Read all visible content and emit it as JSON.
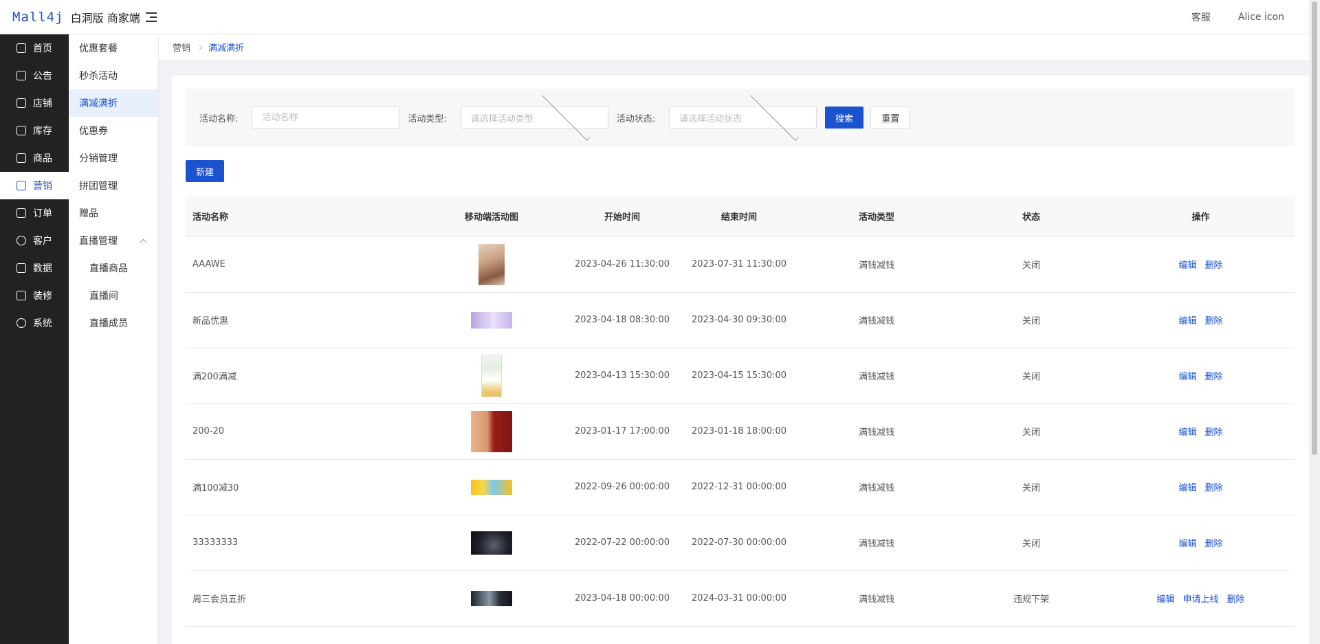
{
  "header": {
    "logo_mark": "Mall4j",
    "logo_text": "白洞版 商家端",
    "service_label": "客服",
    "user_label": "Alice icon"
  },
  "sidebar": {
    "items": [
      {
        "label": "首页",
        "icon": "home-icon"
      },
      {
        "label": "公告",
        "icon": "notice-icon"
      },
      {
        "label": "店铺",
        "icon": "shop-icon"
      },
      {
        "label": "库存",
        "icon": "inventory-icon"
      },
      {
        "label": "商品",
        "icon": "product-icon"
      },
      {
        "label": "营销",
        "icon": "gift-icon",
        "active": true
      },
      {
        "label": "订单",
        "icon": "order-icon"
      },
      {
        "label": "客户",
        "icon": "user-icon"
      },
      {
        "label": "数据",
        "icon": "data-icon"
      },
      {
        "label": "装修",
        "icon": "decorate-icon"
      },
      {
        "label": "系统",
        "icon": "settings-icon"
      }
    ]
  },
  "submenu": {
    "items": [
      {
        "label": "优惠套餐"
      },
      {
        "label": "秒杀活动"
      },
      {
        "label": "满减满折",
        "active": true
      },
      {
        "label": "优惠券"
      },
      {
        "label": "分销管理"
      },
      {
        "label": "拼团管理"
      },
      {
        "label": "赠品"
      },
      {
        "label": "直播管理"
      },
      {
        "label": "直播商品"
      },
      {
        "label": "直播间"
      },
      {
        "label": "直播成员"
      }
    ]
  },
  "breadcrumb": {
    "parent": "营销",
    "current": "满减满折"
  },
  "search": {
    "name_label": "活动名称:",
    "name_placeholder": "活动名称",
    "type_label": "活动类型:",
    "type_placeholder": "请选择活动类型",
    "status_label": "活动状态:",
    "status_placeholder": "请选择活动状态",
    "search_button": "搜索",
    "reset_button": "重置"
  },
  "new_button": "新建",
  "table": {
    "columns": [
      "活动名称",
      "移动端活动图",
      "开始时间",
      "结束时间",
      "活动类型",
      "状态",
      "操作"
    ],
    "rows": [
      {
        "name": "AAAWE",
        "start": "2023-04-26 11:30:00",
        "end": "2023-07-31 11:30:00",
        "type": "满钱减钱",
        "status": "关闭",
        "ops": [
          "编辑",
          "删除"
        ]
      },
      {
        "name": "新品优惠",
        "start": "2023-04-18 08:30:00",
        "end": "2023-04-30 09:30:00",
        "type": "满钱减钱",
        "status": "关闭",
        "ops": [
          "编辑",
          "删除"
        ]
      },
      {
        "name": "满200满减",
        "start": "2023-04-13 15:30:00",
        "end": "2023-04-15 15:30:00",
        "type": "满钱减钱",
        "status": "关闭",
        "ops": [
          "编辑",
          "删除"
        ]
      },
      {
        "name": "200-20",
        "start": "2023-01-17 17:00:00",
        "end": "2023-01-18 18:00:00",
        "type": "满钱减钱",
        "status": "关闭",
        "ops": [
          "编辑",
          "删除"
        ]
      },
      {
        "name": "满100减30",
        "start": "2022-09-26 00:00:00",
        "end": "2022-12-31 00:00:00",
        "type": "满钱减钱",
        "status": "关闭",
        "ops": [
          "编辑",
          "删除"
        ]
      },
      {
        "name": "33333333",
        "start": "2022-07-22 00:00:00",
        "end": "2022-07-30 00:00:00",
        "type": "满钱减钱",
        "status": "关闭",
        "ops": [
          "编辑",
          "删除"
        ]
      },
      {
        "name": "周三会员五折",
        "start": "2023-04-18 00:00:00",
        "end": "2024-03-31 00:00:00",
        "type": "满钱减钱",
        "status": "违规下架",
        "ops": [
          "编辑",
          "申请上线",
          "删除"
        ]
      }
    ]
  }
}
